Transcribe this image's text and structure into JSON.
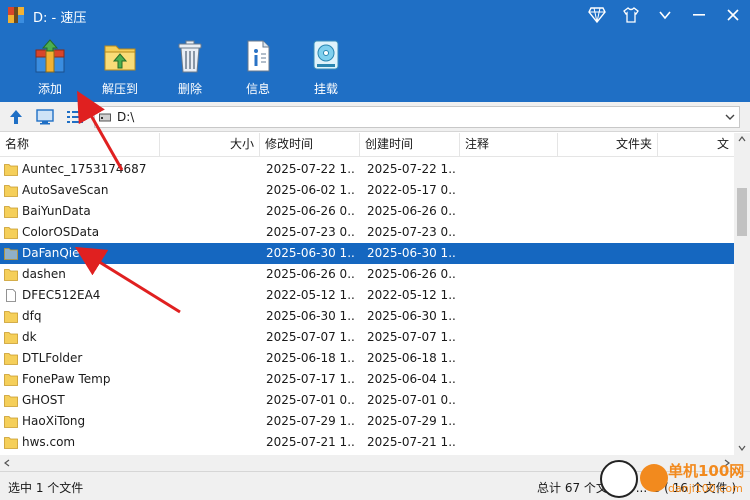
{
  "window": {
    "title": "D: - 速压",
    "controls": [
      "skin-icon",
      "shirt-icon",
      "menu-icon",
      "minimize-icon",
      "close-icon"
    ]
  },
  "toolbar": {
    "items": [
      {
        "label": "添加",
        "icon": "add-archive-icon"
      },
      {
        "label": "解压到",
        "icon": "extract-folder-icon"
      },
      {
        "label": "删除",
        "icon": "trash-icon"
      },
      {
        "label": "信息",
        "icon": "info-document-icon"
      },
      {
        "label": "挂载",
        "icon": "mount-disk-icon"
      }
    ]
  },
  "address": {
    "path": "D:\\"
  },
  "columns": {
    "name": "名称",
    "size": "大小",
    "modified": "修改时间",
    "created": "创建时间",
    "comment": "注释",
    "folder": "文件夹",
    "extra": "文"
  },
  "files": [
    {
      "name": "Auntec_1753174687",
      "modified": "2025-07-22 1...",
      "created": "2025-07-22 1...",
      "type": "folder"
    },
    {
      "name": "AutoSaveScan",
      "modified": "2025-06-02 1...",
      "created": "2022-05-17 0...",
      "type": "folder"
    },
    {
      "name": "BaiYunData",
      "modified": "2025-06-26 0...",
      "created": "2025-06-26 0...",
      "type": "folder"
    },
    {
      "name": "ColorOSData",
      "modified": "2025-07-23 0...",
      "created": "2025-07-23 0...",
      "type": "folder"
    },
    {
      "name": "DaFanQie",
      "modified": "2025-06-30 1...",
      "created": "2025-06-30 1...",
      "type": "folder",
      "selected": true
    },
    {
      "name": "dashen",
      "modified": "2025-06-26 0...",
      "created": "2025-06-26 0...",
      "type": "folder"
    },
    {
      "name": "DFEC512EA4",
      "modified": "2022-05-12 1...",
      "created": "2022-05-12 1...",
      "type": "file"
    },
    {
      "name": "dfq",
      "modified": "2025-06-30 1...",
      "created": "2025-06-30 1...",
      "type": "folder"
    },
    {
      "name": "dk",
      "modified": "2025-07-07 1...",
      "created": "2025-07-07 1...",
      "type": "folder"
    },
    {
      "name": "DTLFolder",
      "modified": "2025-06-18 1...",
      "created": "2025-06-18 1...",
      "type": "folder"
    },
    {
      "name": "FonePaw Temp",
      "modified": "2025-07-17 1...",
      "created": "2025-06-04 1...",
      "type": "folder"
    },
    {
      "name": "GHOST",
      "modified": "2025-07-01 0...",
      "created": "2025-07-01 0...",
      "type": "folder"
    },
    {
      "name": "HaoXiTong",
      "modified": "2025-07-29 1...",
      "created": "2025-07-29 1...",
      "type": "folder"
    },
    {
      "name": "hws.com",
      "modified": "2025-07-21 1...",
      "created": "2025-07-21 1...",
      "type": "folder"
    }
  ],
  "status": {
    "left": "选中 1 个文件",
    "right": "总计 67 个文件夹 ... G ( 16 个文件 )"
  },
  "watermark": {
    "line1": "单机100网",
    "line2": "danji100.com"
  },
  "colors": {
    "accent": "#1f6fc5",
    "selection": "#1567c0",
    "arrow": "#e02020",
    "folder": "#f5cf5a"
  }
}
